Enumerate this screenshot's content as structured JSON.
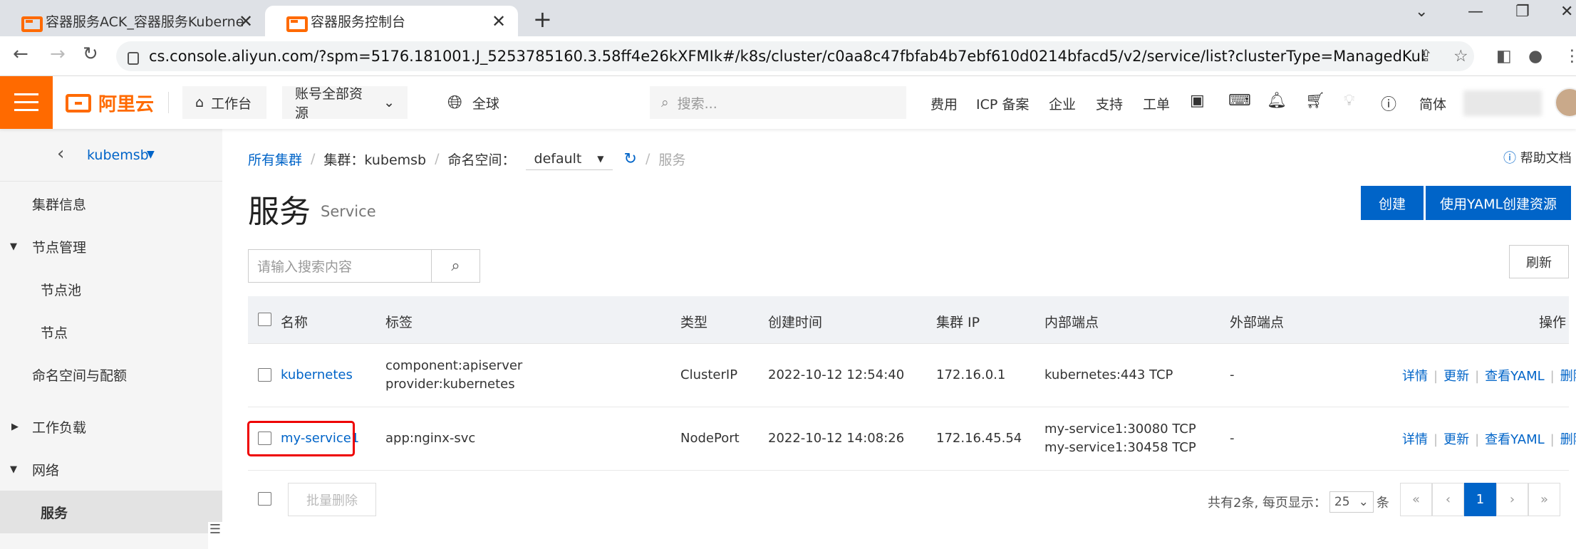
{
  "browser": {
    "tabs": [
      {
        "title": "容器服务ACK_容器服务Kuberne"
      },
      {
        "title": "容器服务控制台"
      }
    ],
    "url": "cs.console.aliyun.com/?spm=5176.181001.J_5253785160.3.58ff4e26kXFMIk#/k8s/cluster/c0aa8c47fbfab4b7ebf610d0214bfacd5/v2/service/list?clusterType=ManagedKubern..."
  },
  "topbar": {
    "logo": "阿里云",
    "workbench": "工作台",
    "resources": "账号全部资源",
    "global": "全球",
    "search_placeholder": "搜索...",
    "links": [
      "费用",
      "ICP 备案",
      "企业",
      "支持",
      "工单"
    ],
    "lang": "简体"
  },
  "sidebar": {
    "cluster": "kubemsb",
    "items": [
      {
        "label": "集群信息"
      },
      {
        "label": "节点管理"
      },
      {
        "label": "节点池"
      },
      {
        "label": "节点"
      },
      {
        "label": "命名空间与配额"
      },
      {
        "label": "工作负载"
      },
      {
        "label": "网络"
      },
      {
        "label": "服务"
      }
    ]
  },
  "breadcrumb": {
    "all": "所有集群",
    "cluster": "集群：kubemsb",
    "ns_label": "命名空间：",
    "ns_value": "default",
    "current": "服务"
  },
  "help": "帮助文档",
  "page": {
    "title": "服务",
    "subtitle": "Service",
    "create": "创建",
    "create_yaml": "使用YAML创建资源",
    "search_placeholder": "请输入搜索内容",
    "refresh": "刷新"
  },
  "table": {
    "headers": [
      "名称",
      "标签",
      "类型",
      "创建时间",
      "集群 IP",
      "内部端点",
      "外部端点",
      "操作"
    ],
    "rows": [
      {
        "name": "kubernetes",
        "labels": [
          "component:apiserver",
          "provider:kubernetes"
        ],
        "type": "ClusterIP",
        "created": "2022-10-12 12:54:40",
        "ip": "172.16.0.1",
        "internal": [
          "kubernetes:443 TCP"
        ],
        "external": "-"
      },
      {
        "name": "my-service1",
        "labels": [
          "app:nginx-svc"
        ],
        "type": "NodePort",
        "created": "2022-10-12 14:08:26",
        "ip": "172.16.45.54",
        "internal": [
          "my-service1:30080 TCP",
          "my-service1:30458 TCP"
        ],
        "external": "-"
      }
    ],
    "actions": [
      "详情",
      "更新",
      "查看YAML",
      "删除"
    ]
  },
  "footer": {
    "bulk_delete": "批量删除",
    "total": "共有2条, 每页显示：",
    "page_size": "25",
    "unit": "条",
    "current_page": "1"
  }
}
